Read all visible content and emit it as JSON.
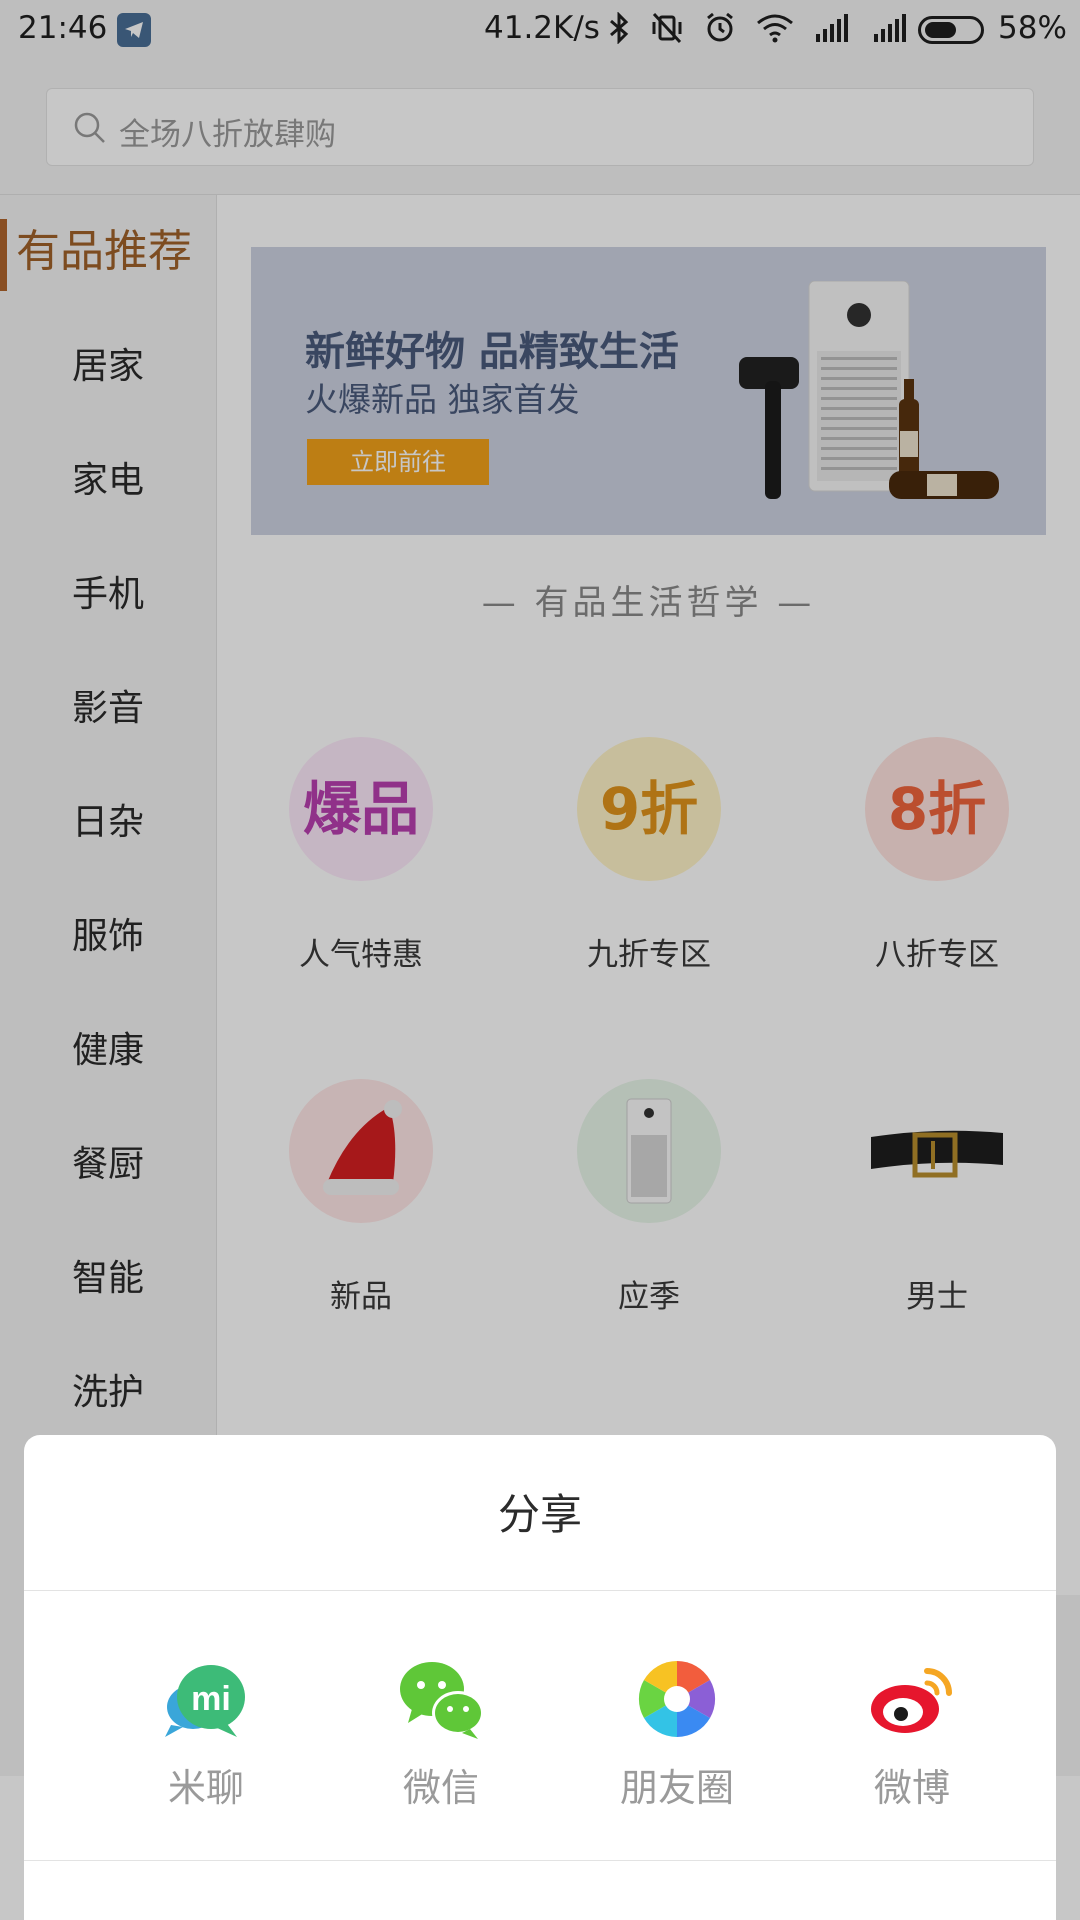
{
  "status_bar": {
    "time": "21:46",
    "network_speed": "41.2K/s",
    "battery_percent": "58%",
    "battery_level": 0.58,
    "icons": [
      "telegram-icon",
      "bluetooth-icon",
      "vibrate-off-icon",
      "alarm-icon",
      "wifi-icon",
      "signal-icon",
      "signal-icon"
    ]
  },
  "search": {
    "placeholder": "全场八折放肆购"
  },
  "sidebar": {
    "items": [
      {
        "label": "有品推荐",
        "active": true
      },
      {
        "label": "居家"
      },
      {
        "label": "家电"
      },
      {
        "label": "手机"
      },
      {
        "label": "影音"
      },
      {
        "label": "日杂"
      },
      {
        "label": "服饰"
      },
      {
        "label": "健康"
      },
      {
        "label": "餐厨"
      },
      {
        "label": "智能"
      },
      {
        "label": "洗护"
      }
    ]
  },
  "banner": {
    "title": "新鲜好物 品精致生活",
    "subtitle": "火爆新品 独家首发",
    "button": "立即前往"
  },
  "section_title": "— 有品生活哲学 —",
  "categories": [
    {
      "badge": "爆品",
      "label": "人气特惠",
      "color": "#b93fb0",
      "bg": "#fde9fa"
    },
    {
      "badge": "9折",
      "label": "九折专区",
      "color": "#e0941b",
      "bg": "#fff4c8"
    },
    {
      "badge": "8折",
      "label": "八折专区",
      "color": "#f0643d",
      "bg": "#ffe3df"
    },
    {
      "label": "新品",
      "icon": "santa-hat-icon",
      "bg": "#ffe7e7"
    },
    {
      "label": "应季",
      "icon": "air-purifier-icon",
      "bg": "#e8f6e9"
    },
    {
      "label": "男士",
      "icon": "belt-icon",
      "bg": "#ffffff"
    }
  ],
  "share_sheet": {
    "title": "分享",
    "options": [
      {
        "label": "米聊",
        "icon": "miliao-icon"
      },
      {
        "label": "微信",
        "icon": "wechat-icon"
      },
      {
        "label": "朋友圈",
        "icon": "moments-icon"
      },
      {
        "label": "微博",
        "icon": "weibo-icon"
      }
    ]
  },
  "colors": {
    "accent": "#b0642c",
    "banner_button": "#f2a21a",
    "miliao": "#3dbb78",
    "wechat": "#5fc738",
    "weibo": "#e6162d"
  }
}
